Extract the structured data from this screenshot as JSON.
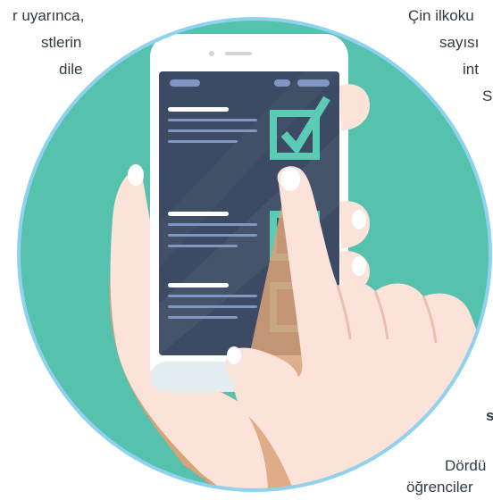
{
  "left_text": [
    "r uyarınca,",
    "stlerin",
    "dile"
  ],
  "right_text": [
    "Çin ilkoku",
    "sayısı",
    "int",
    "S"
  ],
  "bottom_right_text": [
    "s",
    "Dördü",
    "öğrenciler"
  ],
  "colors": {
    "circle_fill": "#56c1ad",
    "circle_ring": "#8fd2ef",
    "phone_body": "#ffffff",
    "screen": "#3d4a63",
    "check_accent": "#5ccbb5",
    "skin": "#fbe3da",
    "skin_shadow": "#d9a278"
  },
  "illustration": {
    "subject": "hand-holding-phone-checklist",
    "checklist_items": [
      {
        "checked": true
      },
      {
        "checked": false
      },
      {
        "checked": false
      }
    ]
  }
}
